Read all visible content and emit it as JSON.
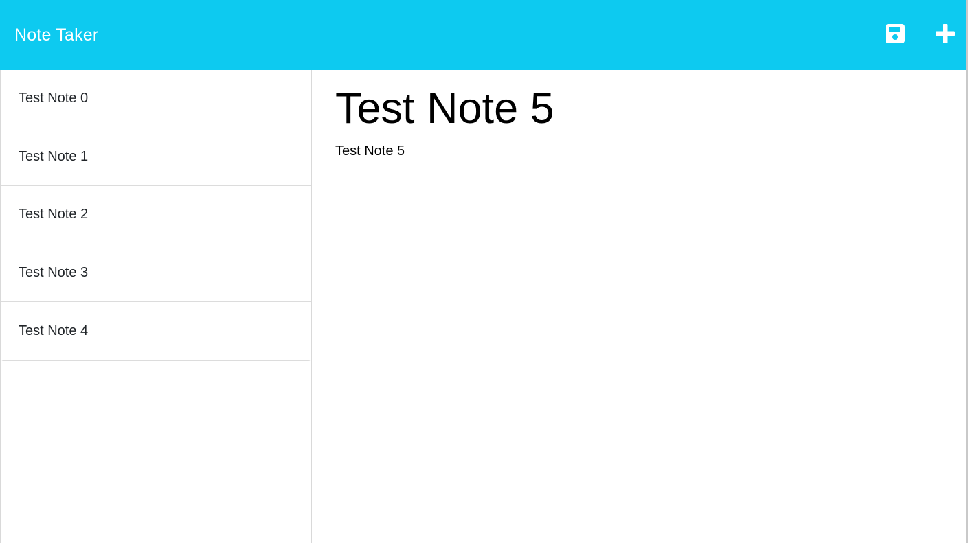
{
  "app": {
    "brand": "Note Taker"
  },
  "toolbar": {
    "save_icon": "save-icon",
    "add_icon": "plus-icon",
    "accent_color": "#0dcaf0"
  },
  "sidebar": {
    "notes": [
      {
        "label": "Test Note 0"
      },
      {
        "label": "Test Note 1"
      },
      {
        "label": "Test Note 2"
      },
      {
        "label": "Test Note 3"
      },
      {
        "label": "Test Note 4"
      }
    ]
  },
  "editor": {
    "title": "Test Note 5",
    "body": "Test Note 5"
  }
}
